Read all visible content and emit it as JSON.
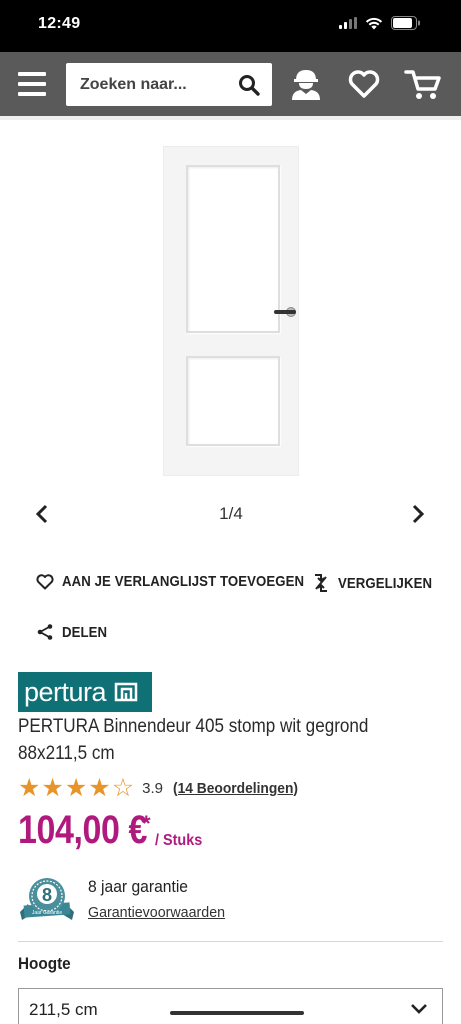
{
  "status_bar": {
    "time": "12:49"
  },
  "header": {
    "search": {
      "placeholder": "Zoeken naar..."
    }
  },
  "icons": {
    "menu": "hamburger-icon",
    "search": "search-icon",
    "account": "worker-icon",
    "wishlist": "heart-icon",
    "cart": "cart-icon"
  },
  "gallery": {
    "counter": "1/4"
  },
  "actions": {
    "wishlist": "AAN JE VERLANGLIJST TOEVOEGEN",
    "compare": "VERGELIJKEN",
    "share": "DELEN"
  },
  "product": {
    "brand": "pertura",
    "title_line1": "PERTURA Binnendeur 405 stomp wit gegrond",
    "title_line2": "88x211,5 cm",
    "rating": {
      "value": 3.9,
      "value_text": "3.9",
      "stars_filled": 4,
      "stars_total": 5,
      "reviews_link": "(14 Beoordelingen)"
    },
    "price": "104,00 €",
    "price_mark": "*",
    "price_unit": "/ Stuks",
    "warranty": {
      "badge_number": "8",
      "badge_text": "Jaar Garantie",
      "title": "8 jaar garantie",
      "link": "Garantievoorwaarden"
    }
  },
  "options": {
    "height_label": "Hoogte",
    "height_value": "211,5 cm"
  },
  "colors": {
    "brand_teal": "#0f7076",
    "price_magenta": "#b01a7f",
    "star_orange": "#e8942a",
    "header_grey": "#5a5a5a"
  }
}
